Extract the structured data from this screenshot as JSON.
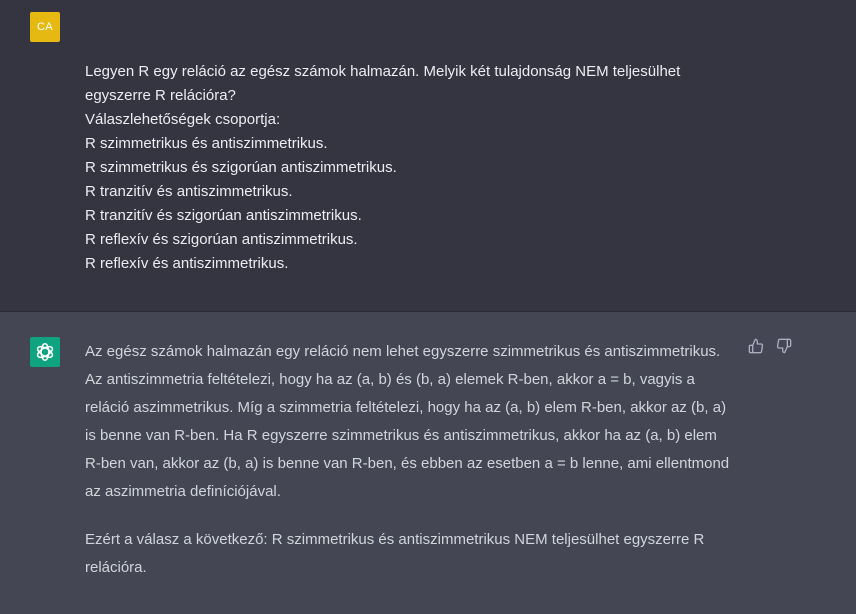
{
  "user_message": {
    "avatar_initials": "CA",
    "avatar_color": "#e6b912",
    "lines": [
      "Legyen R egy reláció az egész számok halmazán. Melyik két tulajdonság NEM teljesülhet",
      "egyszerre R relációra?",
      "Válaszlehetőségek csoportja:",
      "R szimmetrikus és antiszimmetrikus.",
      "R szimmetrikus és szigorúan antiszimmetrikus.",
      "R tranzitív és antiszimmetrikus.",
      "R tranzitív és szigorúan antiszimmetrikus.",
      "R reflexív és szigorúan antiszimmetrikus.",
      "R reflexív és antiszimmetrikus."
    ]
  },
  "assistant_message": {
    "avatar_icon": "openai-logo-icon",
    "avatar_color": "#10a37f",
    "paragraphs": [
      "Az egész számok halmazán egy reláció nem lehet egyszerre szimmetrikus és antiszimmetrikus. Az antiszimmetria feltételezi, hogy ha az (a, b) és (b, a) elemek R-ben, akkor a = b, vagyis a reláció aszimmetrikus. Míg a szimmetria feltételezi, hogy ha az (a, b) elem R-ben, akkor az (b, a) is benne van R-ben. Ha R egyszerre szimmetrikus és antiszimmetrikus, akkor ha az (a, b) elem R-ben van, akkor az (b, a) is benne van R-ben, és ebben az esetben a = b lenne, ami ellentmond az aszimmetria definíciójával.",
      "Ezért a válasz a következő: R szimmetrikus és antiszimmetrikus NEM teljesülhet egyszerre R relációra."
    ],
    "feedback_icons": [
      "thumbs-up-icon",
      "thumbs-down-icon"
    ]
  }
}
